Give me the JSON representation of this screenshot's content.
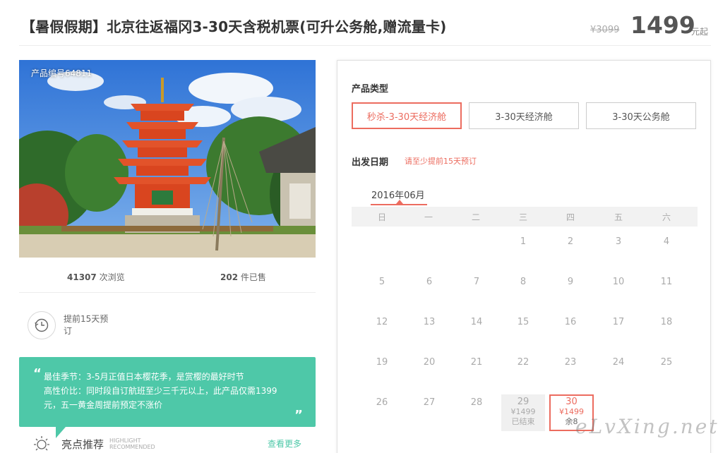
{
  "header": {
    "title": "【暑假假期】北京往返福冈3-30天含税机票(可升公务舱,赠流量卡)",
    "original_price": "¥3099",
    "price": "1499",
    "price_unit": "元起"
  },
  "left": {
    "product_code": "产品编号64811",
    "views_count": "41307",
    "views_label": " 次浏览",
    "sold_count": "202",
    "sold_label": " 件已售",
    "booking_text": "提前15天预订",
    "quote": {
      "line1": "最佳季节：3-5月正值日本樱花季，是赏樱的最好时节",
      "line2": "高性价比：同时段自订航班至少三千元以上，此产品仅需1399",
      "line3": "元，五一黄金周提前预定不涨价",
      "open_mark": "“",
      "close_mark": "”"
    },
    "highlight_title": "亮点推荐",
    "highlight_en1": "HIGHLIGHT",
    "highlight_en2": "RECOMMENDED",
    "see_more": "查看更多"
  },
  "right": {
    "product_type_label": "产品类型",
    "product_types": [
      "秒杀-3-30天经济舱",
      "3-30天经济舱",
      "3-30天公务舱"
    ],
    "selected_type_index": 0,
    "departure_label": "出发日期",
    "departure_hint": "请至少提前15天预订",
    "month": "2016年06月",
    "weekdays": [
      "日",
      "一",
      "二",
      "三",
      "四",
      "五",
      "六"
    ],
    "weeks": [
      [
        "",
        "",
        "",
        "1",
        "2",
        "3",
        "4"
      ],
      [
        "5",
        "6",
        "7",
        "8",
        "9",
        "10",
        "11"
      ],
      [
        "12",
        "13",
        "14",
        "15",
        "16",
        "17",
        "18"
      ],
      [
        "19",
        "20",
        "21",
        "22",
        "23",
        "24",
        "25"
      ],
      [
        "26",
        "27",
        "28",
        "",
        "",
        "",
        ""
      ]
    ],
    "special_days": {
      "past": {
        "day": "29",
        "price": "¥1499",
        "status": "已结束"
      },
      "available": {
        "day": "30",
        "price": "¥1499",
        "status": "余8"
      }
    }
  },
  "watermark": "eLvXing.net",
  "colors": {
    "accent": "#ec6c5f",
    "teal": "#4ec8a8"
  }
}
